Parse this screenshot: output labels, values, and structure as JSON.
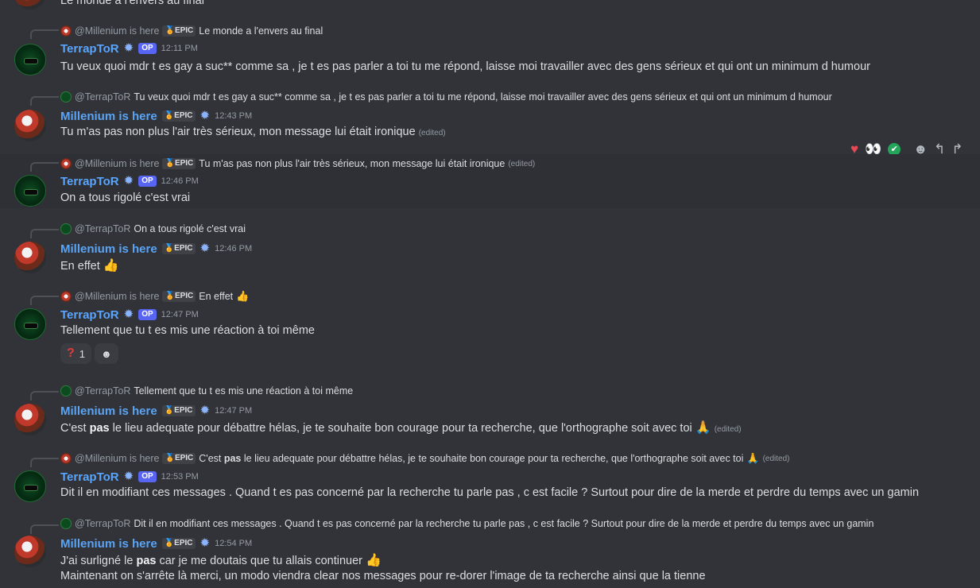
{
  "top_partial": {
    "text": "Le monde a l'envers au final"
  },
  "messages": [
    {
      "reply_name": "@Millenium is here",
      "reply_tag": "EPIC",
      "reply_text": "Le monde a l'envers au final",
      "author": "TerrapToR",
      "tag": "OP",
      "time": "12:11 PM",
      "text": "Tu veux quoi mdr t es gay a suc** comme sa , je t es pas parler a toi tu me répond, laisse moi travailler avec des gens sérieux et qui ont un minimum d humour"
    },
    {
      "reply_name": "@TerrapToR",
      "reply_text": "Tu veux quoi mdr t es gay a suc** comme sa , je t es pas parler a toi tu me répond, laisse moi travailler avec des gens sérieux et qui ont un minimum d humour",
      "author": "Millenium is here",
      "tag": "EPIC",
      "time": "12:43 PM",
      "text": "Tu m'as pas non plus l'air très sérieux, mon message lui était ironique",
      "edited": "(edited)"
    },
    {
      "reply_name": "@Millenium is here",
      "reply_tag": "EPIC",
      "reply_text": "Tu m'as pas non plus l'air très sérieux, mon message lui était ironique",
      "reply_edited": "(edited)",
      "author": "TerrapToR",
      "tag": "OP",
      "time": "12:46 PM",
      "text": "On a tous rigolé c'est vrai"
    },
    {
      "reply_name": "@TerrapToR",
      "reply_text": "On a tous rigolé c'est vrai",
      "author": "Millenium is here",
      "tag": "EPIC",
      "time": "12:46 PM",
      "text": "En effet",
      "emoji": "👍"
    },
    {
      "reply_name": "@Millenium is here",
      "reply_tag": "EPIC",
      "reply_text": "En effet",
      "reply_emoji": "👍",
      "author": "TerrapToR",
      "tag": "OP",
      "time": "12:47 PM",
      "text": "Tellement que tu t es mis une réaction à toi même",
      "reaction_emoji": "?",
      "reaction_count": "1",
      "add_reaction_icon": "☻"
    },
    {
      "reply_name": "@TerrapToR",
      "reply_text": "Tellement que tu t es mis une réaction à toi même",
      "author": "Millenium is here",
      "tag": "EPIC",
      "time": "12:47 PM",
      "text_pre": "C'est ",
      "text_bold": "pas",
      "text_post": " le lieu adequate pour débattre hélas, je te souhaite bon courage pour ta recherche, que l'orthographe soit avec toi",
      "emoji": "🙏",
      "edited": "(edited)"
    },
    {
      "reply_name": "@Millenium is here",
      "reply_tag": "EPIC",
      "reply_pre": "C'est ",
      "reply_bold": "pas",
      "reply_post": " le lieu adequate pour débattre hélas, je te souhaite bon courage pour ta recherche, que l'orthographe soit avec toi",
      "reply_emoji": "🙏",
      "reply_edited": "(edited)",
      "author": "TerrapToR",
      "tag": "OP",
      "time": "12:53 PM",
      "text": "Dit il en modifiant ces messages . Quand t es pas concerné par la recherche tu parle pas , c est facile ? Surtout pour dire de la merde et perdre du temps avec un gamin"
    },
    {
      "reply_name": "@TerrapToR",
      "reply_text": "Dit il en modifiant ces messages . Quand t es pas concerné par la recherche tu parle pas , c est facile ? Surtout pour dire de la merde et perdre du temps avec un gamin",
      "author": "Millenium is here",
      "tag": "EPIC",
      "time": "12:54 PM",
      "text_pre": "J'ai surligné le ",
      "text_bold": "pas",
      "text_post": " car je me doutais que tu allais continuer",
      "emoji": "👍",
      "text_line2": "Maintenant on s'arrête là merci, un modo viendra clear nos messages pour re-dorer l'image de ta recherche ainsi que la tienne"
    }
  ],
  "hover_bar": {
    "heart": "♥",
    "eyes": "👀",
    "check": "✔",
    "add_reaction": "☻",
    "reply": "↰",
    "forward": "↱"
  }
}
